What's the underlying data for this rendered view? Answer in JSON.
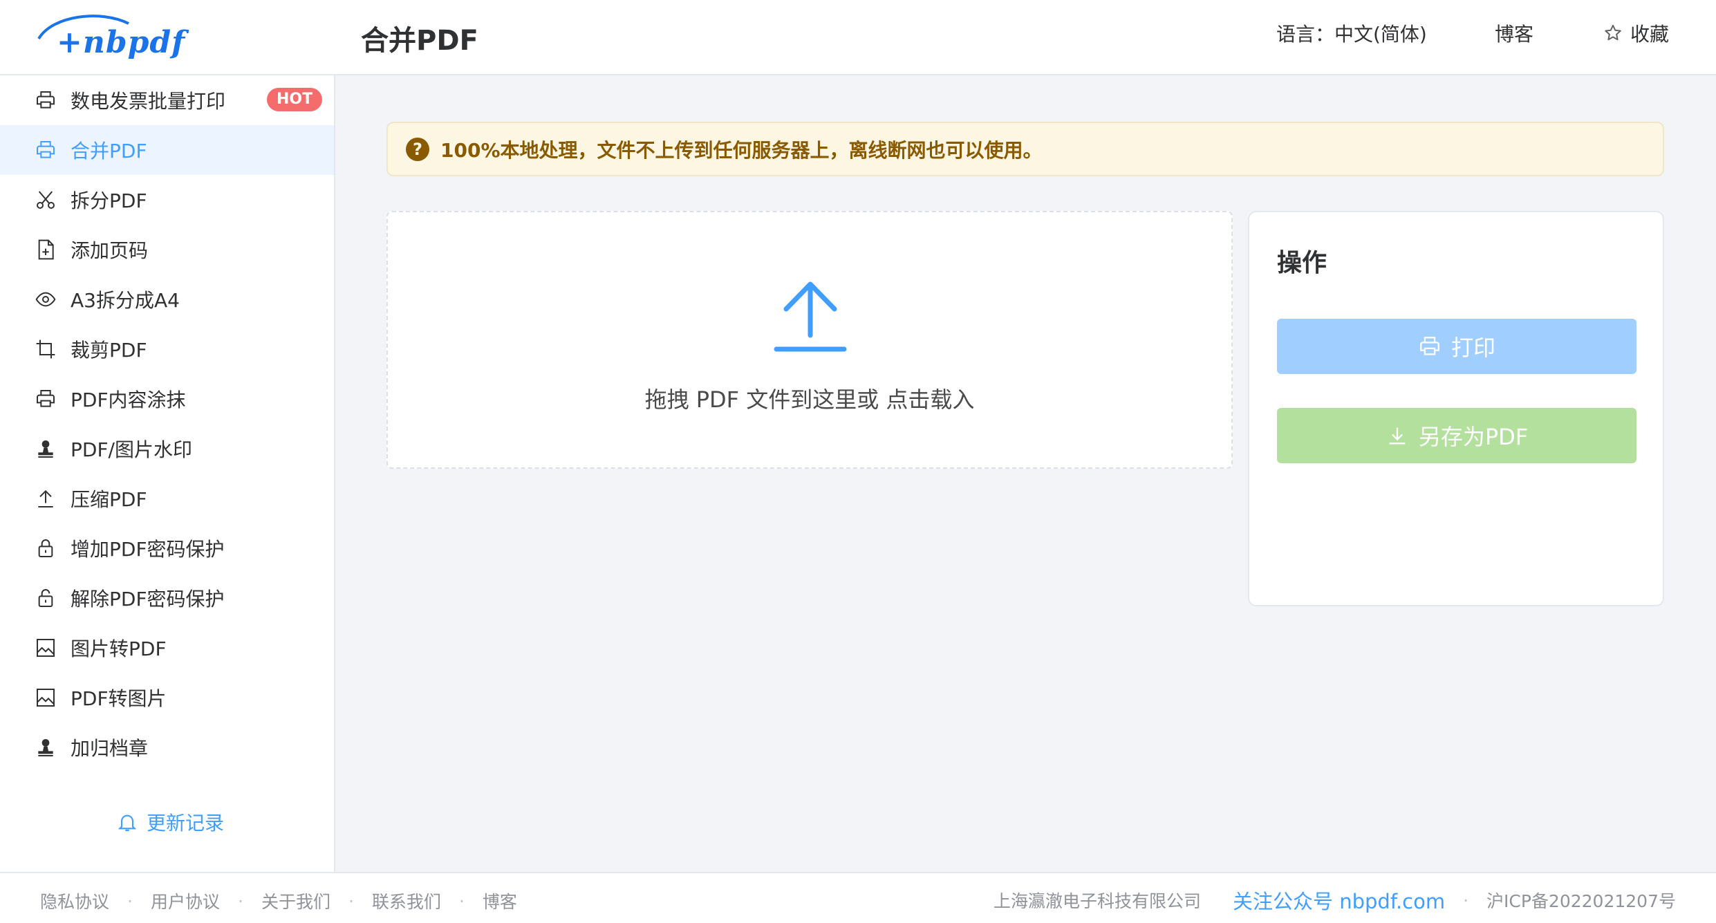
{
  "header": {
    "logo_text": "+nbpdf",
    "page_title": "合并PDF",
    "language": "语言：中文(简体)",
    "blog": "博客",
    "favorite": "收藏"
  },
  "sidebar": {
    "items": [
      {
        "label": "数电发票批量打印",
        "icon": "printer-icon",
        "badge": "HOT"
      },
      {
        "label": "合并PDF",
        "icon": "printer-icon",
        "active": true
      },
      {
        "label": "拆分PDF",
        "icon": "scissors-icon"
      },
      {
        "label": "添加页码",
        "icon": "add-page-icon"
      },
      {
        "label": "A3拆分成A4",
        "icon": "eye-icon"
      },
      {
        "label": "裁剪PDF",
        "icon": "crop-icon"
      },
      {
        "label": "PDF内容涂抹",
        "icon": "printer-icon"
      },
      {
        "label": "PDF/图片水印",
        "icon": "stamp-icon"
      },
      {
        "label": "压缩PDF",
        "icon": "upload-icon"
      },
      {
        "label": "增加PDF密码保护",
        "icon": "lock-icon"
      },
      {
        "label": "解除PDF密码保护",
        "icon": "unlock-icon"
      },
      {
        "label": "图片转PDF",
        "icon": "image-icon"
      },
      {
        "label": "PDF转图片",
        "icon": "image-icon"
      },
      {
        "label": "加归档章",
        "icon": "stamp-icon"
      }
    ],
    "update_link": "更新记录"
  },
  "main": {
    "notice": "100%本地处理，文件不上传到任何服务器上，离线断网也可以使用。",
    "dropzone_text": "拖拽 PDF 文件到这里或 点击载入",
    "ops_title": "操作",
    "print_button": "打印",
    "save_button": "另存为PDF"
  },
  "footer": {
    "links": [
      "隐私协议",
      "用户协议",
      "关于我们",
      "联系我们",
      "博客"
    ],
    "company": "上海瀛澈电子科技有限公司",
    "wechat": "关注公众号 nbpdf.com",
    "icp": "沪ICP备2022021207号"
  },
  "colors": {
    "accent": "#409eff",
    "active_bg": "#ecf5ff",
    "hot_badge": "#f56c6c",
    "notice_bg": "#fdf6e3",
    "notice_text": "#8a5a00",
    "print_button": "#a0cfff",
    "save_button": "#b3e19d"
  }
}
